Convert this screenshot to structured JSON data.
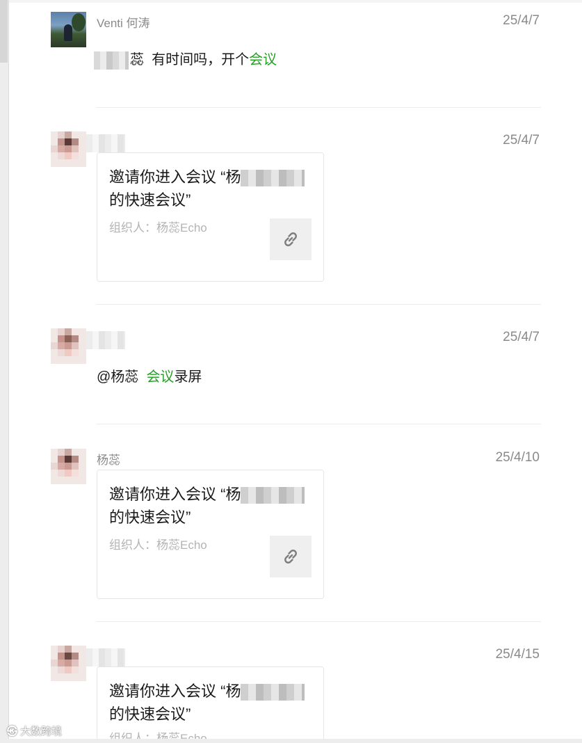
{
  "messages": [
    {
      "sender": "Venti 何涛",
      "time": "25/4/7",
      "text_prefix": "蕊",
      "text_main": "有时间吗，开个",
      "text_link": "会议"
    },
    {
      "sender": "",
      "time": "25/4/7",
      "card": {
        "title_line1": "邀请你进入会议 “杨",
        "title_line2": "的快速会议”",
        "organizer": "组织人：杨蕊Echo",
        "icon": "link-icon"
      }
    },
    {
      "sender": "",
      "time": "25/4/7",
      "text_mention": "@杨蕊",
      "text_link": "会议",
      "text_suffix": "录屏"
    },
    {
      "sender": "杨蕊",
      "time": "25/4/10",
      "card": {
        "title_line1": "邀请你进入会议 “杨",
        "title_line2": "的快速会议”",
        "organizer": "组织人：杨蕊Echo",
        "icon": "link-icon"
      }
    },
    {
      "sender": "",
      "time": "25/4/15",
      "card": {
        "title_line1": "邀请你进入会议 “杨",
        "title_line2": "的快速会议”",
        "organizer": "组织人：杨蕊Echo",
        "icon": "link-icon"
      }
    }
  ],
  "watermark": "大数跨境",
  "colors": {
    "link_green": "#27a026",
    "meta_gray": "#8a8a8a",
    "card_border": "#e6e6e6"
  }
}
